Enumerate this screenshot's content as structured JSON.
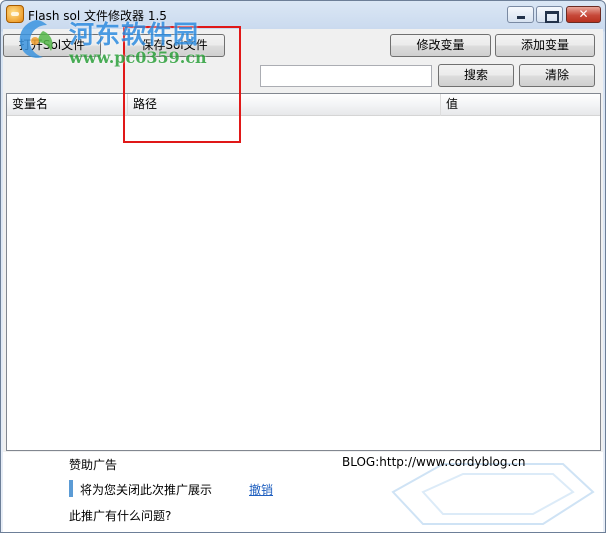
{
  "window": {
    "title": "Flash sol 文件修改器 1.5"
  },
  "toolbar": {
    "open_label": "打开Sol文件",
    "save_label": "保存Sol文件",
    "modify_label": "修改变量",
    "add_label": "添加变量",
    "search_label": "搜索",
    "clear_label": "清除"
  },
  "search": {
    "value": "",
    "placeholder": ""
  },
  "list": {
    "columns": [
      "变量名",
      "路径",
      "值"
    ],
    "rows": []
  },
  "ad": {
    "label": "赞助广告",
    "blog": "BLOG:http://www.cordyblog.cn",
    "message": "将为您关闭此次推广展示",
    "undo_link": "撤销",
    "question": "此推广有什么问题?"
  },
  "watermark": {
    "title": "河东软件园",
    "url": "www.pc0359.cn"
  },
  "colors": {
    "highlight": "#e01818",
    "link": "#1f5fbf",
    "watermark_blue": "#2f8de0",
    "watermark_green": "#2da13c"
  },
  "icons": {
    "app": "flash-sol-app-icon",
    "minimize": "minimize-icon",
    "maximize": "maximize-icon",
    "close": "close-icon"
  }
}
